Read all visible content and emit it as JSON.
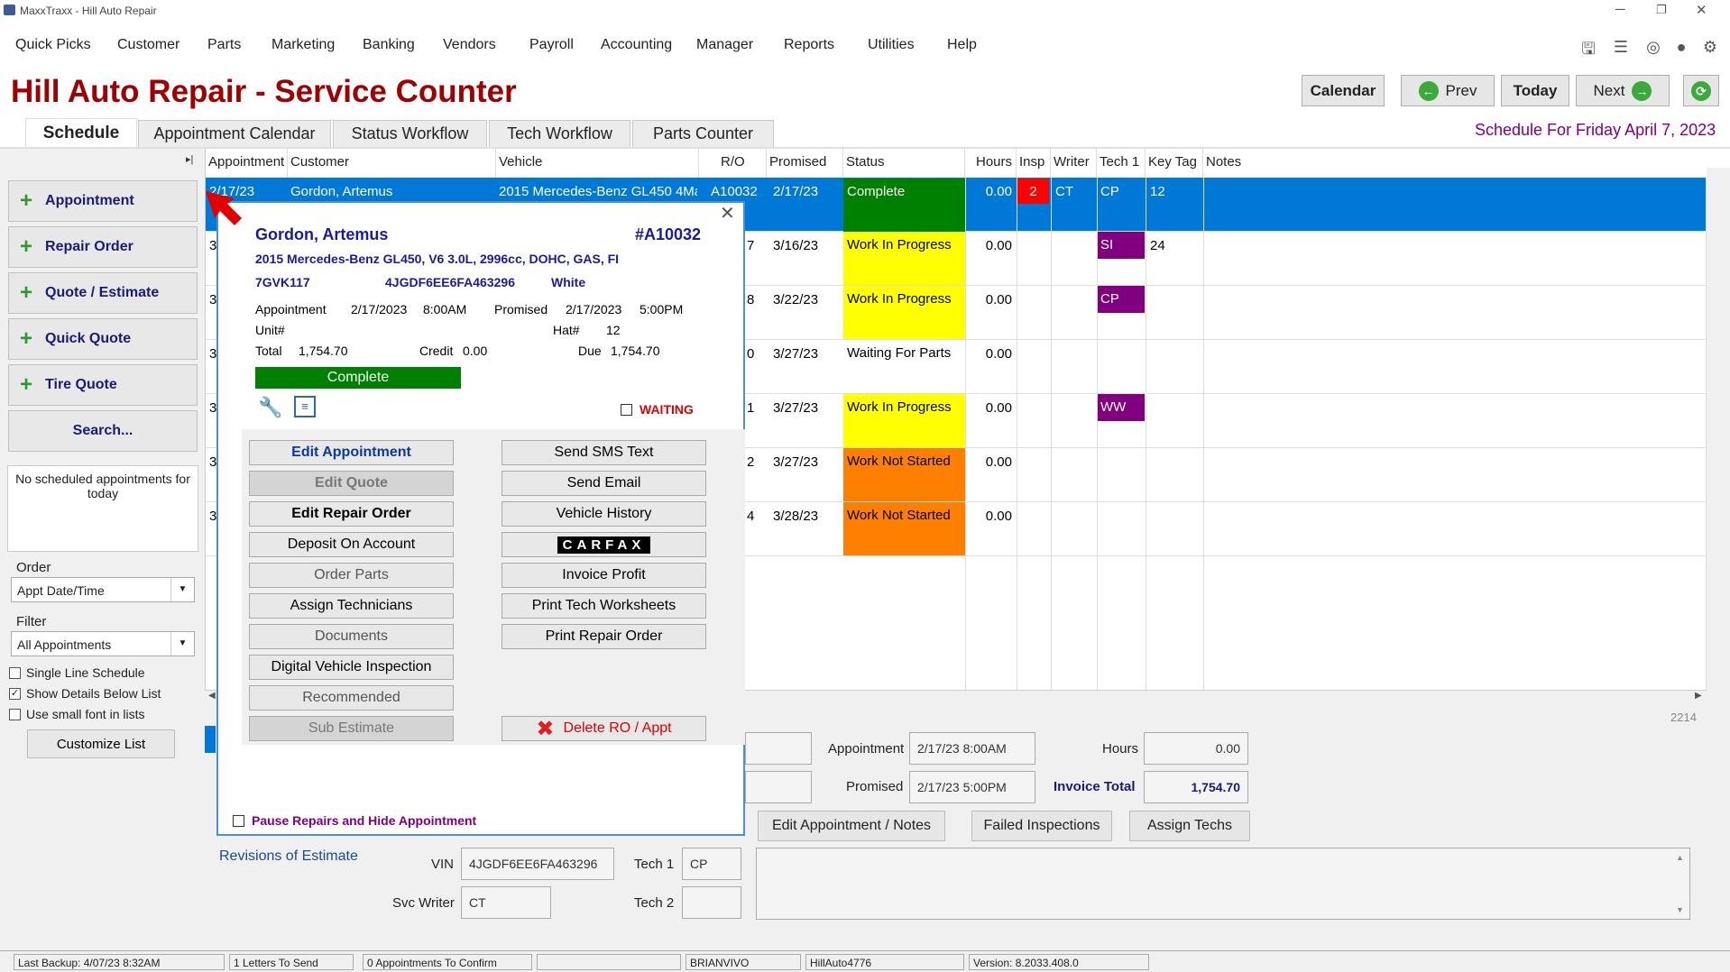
{
  "window": {
    "title": "MaxxTraxx - Hill Auto Repair"
  },
  "menu": [
    "Quick Picks",
    "Customer",
    "Parts",
    "Marketing",
    "Banking",
    "Vendors",
    "Payroll",
    "Accounting",
    "Manager",
    "Reports",
    "Utilities",
    "Help"
  ],
  "header": {
    "title": "Hill Auto Repair - Service Counter",
    "calendar": "Calendar",
    "prev": "Prev",
    "today": "Today",
    "next": "Next",
    "schedule_for": "Schedule For Friday April  7, 2023"
  },
  "tabs": [
    "Schedule",
    "Appointment Calendar",
    "Status Workflow",
    "Tech Workflow",
    "Parts Counter"
  ],
  "left": {
    "buttons": [
      "Appointment",
      "Repair Order",
      "Quote / Estimate",
      "Quick Quote",
      "Tire Quote"
    ],
    "search": "Search...",
    "no_appts": "No scheduled appointments for today",
    "order_label": "Order",
    "order_value": "Appt Date/Time",
    "filter_label": "Filter",
    "filter_value": "All Appointments",
    "checks": [
      {
        "label": "Single Line Schedule",
        "checked": false
      },
      {
        "label": "Show Details Below List",
        "checked": true
      },
      {
        "label": "Use small font in lists",
        "checked": false
      }
    ],
    "customize": "Customize List"
  },
  "grid": {
    "headers": [
      "Appointment",
      "Customer",
      "Vehicle",
      "R/O",
      "Promised",
      "Status",
      "Hours",
      "Insp",
      "Writer",
      "Tech 1",
      "Key Tag",
      "Notes"
    ],
    "rows": [
      {
        "appt": "2/17/23",
        "customer": "Gordon, Artemus",
        "vehicle": "2015 Mercedes-Benz  GL450 4Ma",
        "ro": "A10032",
        "promised": "2/17/23",
        "status": "Complete",
        "hours": "0.00",
        "insp": "2",
        "writer": "CT",
        "tech": "CP",
        "keytag": "12",
        "status_color": "#008000",
        "tech_color": ""
      },
      {
        "appt": "3",
        "customer": "",
        "vehicle": "",
        "ro": "7",
        "promised": "3/16/23",
        "status": "Work In Progress",
        "hours": "0.00",
        "insp": "",
        "writer": "",
        "tech": "SI",
        "keytag": "24",
        "status_color": "#ffff00",
        "tech_color": "#800080"
      },
      {
        "appt": "3",
        "customer": "",
        "vehicle": "",
        "ro": "8",
        "promised": "3/22/23",
        "status": "Work In Progress",
        "hours": "0.00",
        "insp": "",
        "writer": "",
        "tech": "CP",
        "keytag": "",
        "status_color": "#ffff00",
        "tech_color": "#800080"
      },
      {
        "appt": "3",
        "customer": "",
        "vehicle": "",
        "ro": "0",
        "promised": "3/27/23",
        "status": "Waiting For Parts",
        "hours": "0.00",
        "insp": "",
        "writer": "",
        "tech": "",
        "keytag": "",
        "status_color": "",
        "tech_color": ""
      },
      {
        "appt": "3",
        "customer": "",
        "vehicle": "",
        "ro": "1",
        "promised": "3/27/23",
        "status": "Work In Progress",
        "hours": "0.00",
        "insp": "",
        "writer": "",
        "tech": "WW",
        "keytag": "",
        "status_color": "#ffff00",
        "tech_color": "#800080"
      },
      {
        "appt": "3",
        "customer": "",
        "vehicle": "",
        "ro": "2",
        "promised": "3/27/23",
        "status": "Work Not Started",
        "hours": "0.00",
        "insp": "",
        "writer": "",
        "tech": "",
        "keytag": "",
        "status_color": "#ff8000",
        "tech_color": ""
      },
      {
        "appt": "3",
        "customer": "",
        "vehicle": "",
        "ro": "4",
        "promised": "3/28/23",
        "status": "Work Not Started",
        "hours": "0.00",
        "insp": "",
        "writer": "",
        "tech": "",
        "keytag": "",
        "status_color": "#ff8000",
        "tech_color": ""
      }
    ]
  },
  "popup": {
    "name": "Gordon, Artemus",
    "ro": "#A10032",
    "vehicle": "2015 Mercedes-Benz  GL450, V6 3.0L, 2996cc, DOHC, GAS, FI",
    "plate": "7GVK117",
    "vin": "4JGDF6EE6FA463296",
    "color": "White",
    "appt_label": "Appointment",
    "appt_date": "2/17/2023",
    "appt_time": "8:00AM",
    "promised_label": "Promised",
    "promised_date": "2/17/2023",
    "promised_time": "5:00PM",
    "unit_label": "Unit#",
    "hat_label": "Hat#",
    "hat": "12",
    "total_label": "Total",
    "total": "1,754.70",
    "credit_label": "Credit",
    "credit": "0.00",
    "due_label": "Due",
    "due": "1,754.70",
    "status": "Complete",
    "waiting": "WAITING",
    "left_buttons": [
      "Edit Appointment",
      "Edit Quote",
      "Edit Repair Order",
      "Deposit On Account",
      "Order Parts",
      "Assign Technicians",
      "Documents",
      "Digital Vehicle Inspection",
      "Recommended",
      "Sub Estimate"
    ],
    "right_buttons": [
      "Send SMS Text",
      "Send Email",
      "Vehicle History",
      "CARFAX",
      "Invoice Profit",
      "Print Tech Worksheets",
      "Print Repair Order"
    ],
    "delete": "Delete RO / Appt",
    "pause": "Pause Repairs and Hide Appointment"
  },
  "details": {
    "count": "2214",
    "appt_label": "Appointment",
    "appt_value": "2/17/23  8:00AM",
    "promised_label": "Promised",
    "promised_value": "2/17/23  5:00PM",
    "hours_label": "Hours",
    "hours_value": "0.00",
    "invoice_label": "Invoice Total",
    "invoice_value": "1,754.70",
    "edit_btn": "Edit Appointment / Notes",
    "failed_btn": "Failed Inspections",
    "assign_btn": "Assign Techs",
    "revisions": "Revisions of Estimate",
    "vin_label": "VIN",
    "vin_value": "4JGDF6EE6FA463296",
    "tech1_label": "Tech 1",
    "tech1_value": "CP",
    "svc_label": "Svc Writer",
    "svc_value": "CT",
    "tech2_label": "Tech 2",
    "tech2_value": ""
  },
  "statusbar": {
    "backup": "Last Backup:  4/07/23   8:32AM",
    "letters": "1 Letters To Send",
    "confirm": "0 Appointments To Confirm",
    "user": "BRIANVIVO",
    "db": "HillAuto4776",
    "version": "Version:  8.2033.408.0"
  }
}
